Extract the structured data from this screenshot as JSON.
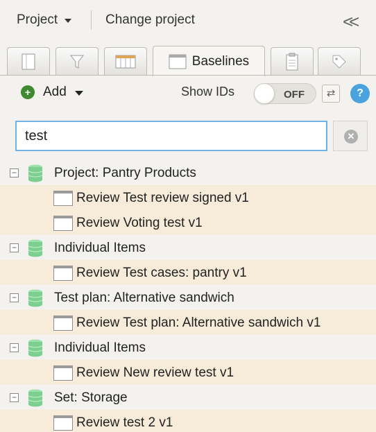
{
  "header": {
    "project_menu": "Project",
    "change_project": "Change project",
    "collapse_glyph": "<<"
  },
  "tabs": [
    {
      "icon": "panel-icon",
      "label": ""
    },
    {
      "icon": "filter-icon",
      "label": ""
    },
    {
      "icon": "grid-icon",
      "label": ""
    },
    {
      "icon": "baseline-icon",
      "label": "Baselines",
      "active": true
    },
    {
      "icon": "clipboard-icon",
      "label": ""
    },
    {
      "icon": "tag-icon",
      "label": ""
    }
  ],
  "toolbar": {
    "add_label": "Add",
    "show_ids_label": "Show IDs",
    "toggle_state": "OFF",
    "swap_glyph": "⇄",
    "help_glyph": "?"
  },
  "search": {
    "value": "test",
    "clear_glyph": "✕"
  },
  "tree": {
    "rows": [
      {
        "type": "group",
        "label": "Project: Pantry Products"
      },
      {
        "type": "item",
        "label": "Review Test review signed v1"
      },
      {
        "type": "item",
        "label": "Review Voting test v1"
      },
      {
        "type": "group",
        "label": "Individual Items"
      },
      {
        "type": "item",
        "label": "Review Test cases: pantry v1"
      },
      {
        "type": "group",
        "label": "Test plan: Alternative sandwich"
      },
      {
        "type": "item",
        "label": "Review Test plan: Alternative sandwich v1"
      },
      {
        "type": "group",
        "label": "Individual Items"
      },
      {
        "type": "item",
        "label": "Review New review test v1"
      },
      {
        "type": "group",
        "label": "Set: Storage"
      },
      {
        "type": "item",
        "label": "Review test 2 v1"
      }
    ],
    "expander_glyph": "−"
  },
  "colors": {
    "accent": "#6fb3e6",
    "item_row_bg": "#f6ecd9",
    "db_icon": "#7ccf8e",
    "add_green": "#3f8a2e",
    "help_blue": "#4aa3df"
  }
}
